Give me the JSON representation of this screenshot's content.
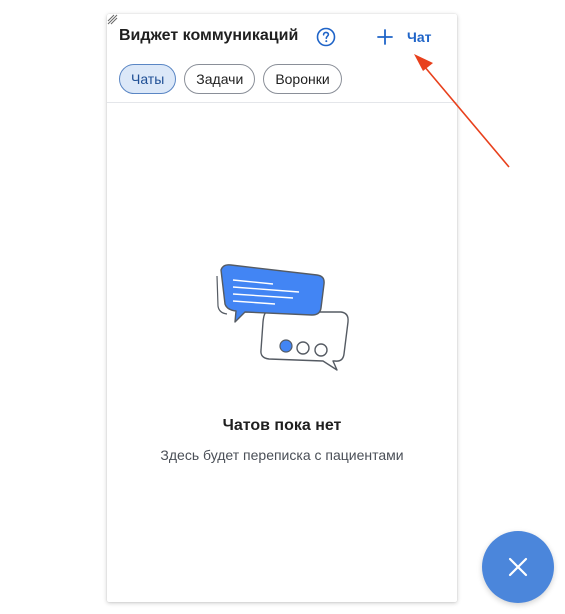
{
  "widget": {
    "title": "Виджет коммуникаций",
    "help_icon": "question-circle-icon",
    "new_chat": {
      "icon": "plus-icon",
      "label": "Чат"
    }
  },
  "tabs": [
    {
      "label": "Чаты",
      "active": true
    },
    {
      "label": "Задачи",
      "active": false
    },
    {
      "label": "Воронки",
      "active": false
    }
  ],
  "empty_state": {
    "illustration": "chat-bubbles-illustration",
    "title": "Чатов пока нет",
    "subtitle": "Здесь будет переписка с пациентами"
  },
  "fab": {
    "icon": "close-icon"
  },
  "colors": {
    "accent": "#1f64c8",
    "tab_active_bg": "#dce8f8",
    "bubble_blue": "#4285f4",
    "fab_bg": "#4b86db",
    "annotation_red": "#e8401c"
  }
}
